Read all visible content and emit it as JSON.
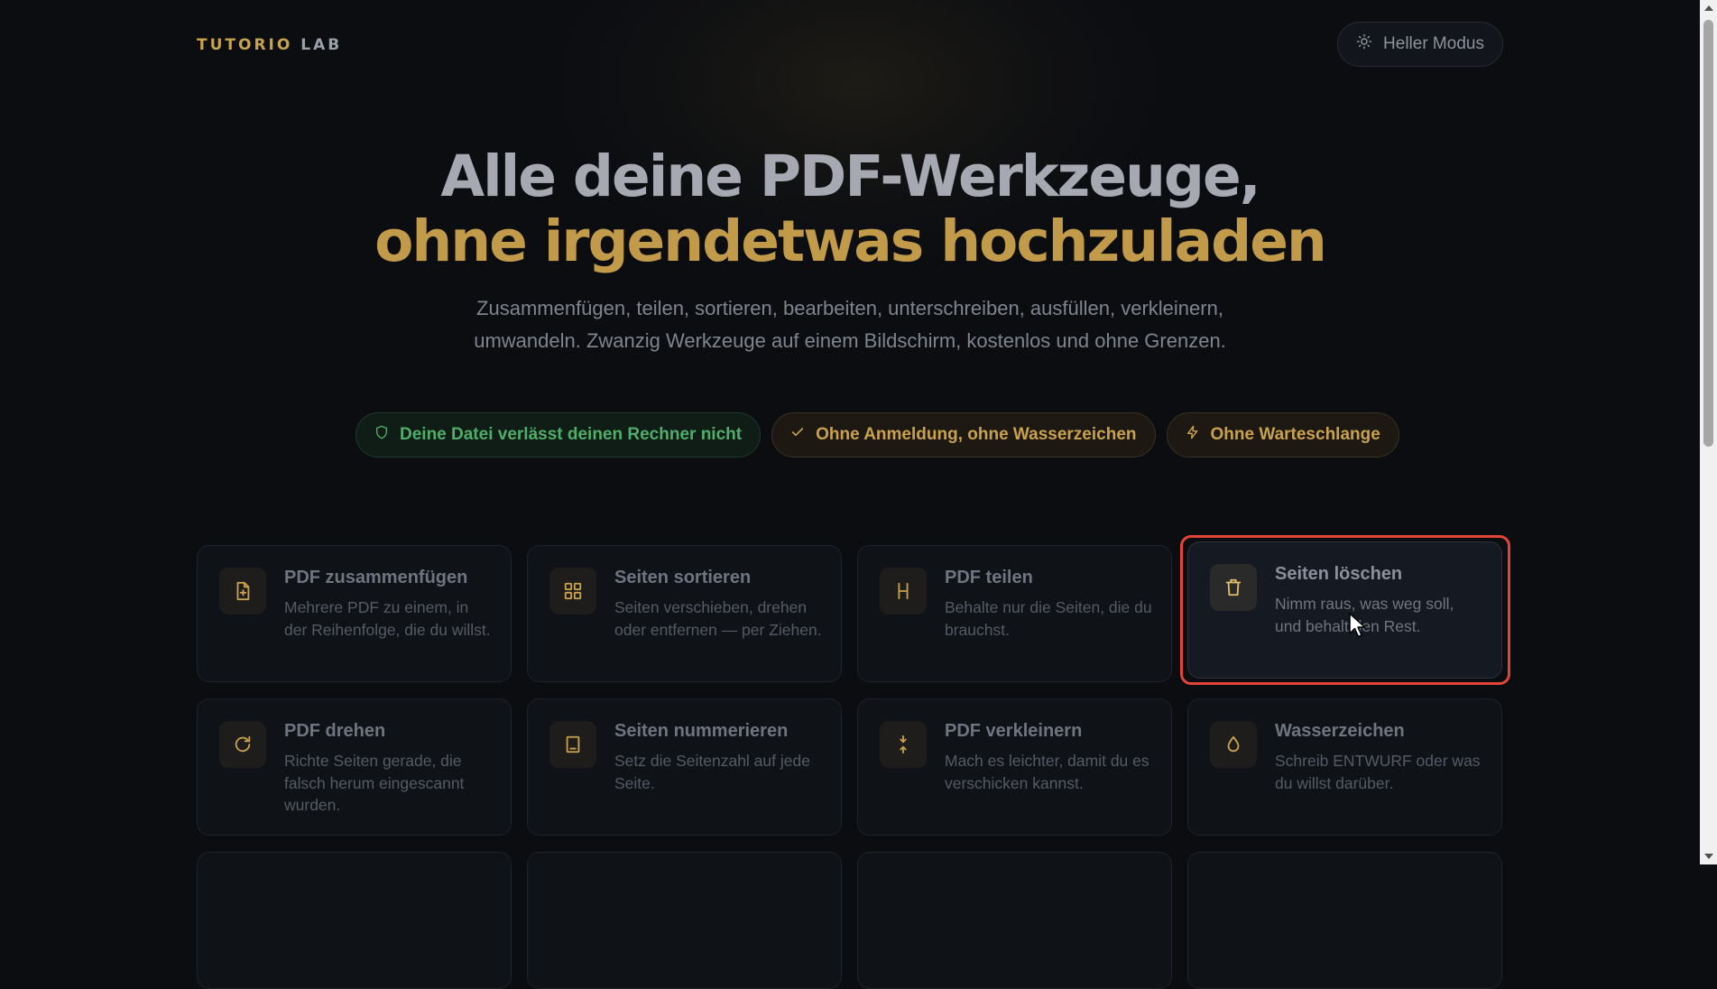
{
  "header": {
    "logo_part1": "TUTORIO",
    "logo_part2": "LAB",
    "mode_button_label": "Heller Modus",
    "mode_button_icon": "sun-icon"
  },
  "hero": {
    "title_line1": "Alle deine PDF-Werkzeuge,",
    "title_line2": "ohne irgendetwas hochzuladen",
    "subtitle": "Zusammenfügen, teilen, sortieren, bearbeiten, unterschreiben, ausfüllen, verkleinern, umwandeln. Zwanzig Werkzeuge auf einem Bildschirm, kostenlos und ohne Grenzen."
  },
  "badges": [
    {
      "label": "Deine Datei verlässt deinen Rechner nicht",
      "icon": "shield-icon",
      "color": "#4fae6a"
    },
    {
      "label": "Ohne Anmeldung, ohne Wasserzeichen",
      "icon": "check-icon",
      "color": "#c9a24e"
    },
    {
      "label": "Ohne Warteschlange",
      "icon": "lightning-icon",
      "color": "#c9a24e"
    }
  ],
  "tools": [
    {
      "title": "PDF zusammenfügen",
      "desc": "Mehrere PDF zu einem, in der Reihenfolge, die du willst.",
      "icon": "file-plus-icon"
    },
    {
      "title": "Seiten sortieren",
      "desc": "Seiten verschieben, drehen oder entfernen — per Ziehen.",
      "icon": "grid-icon"
    },
    {
      "title": "PDF teilen",
      "desc": "Behalte nur die Seiten, die du brauchst.",
      "icon": "split-icon"
    },
    {
      "title": "Seiten löschen",
      "desc": "Nimm raus, was weg soll, und behalt den Rest.",
      "icon": "trash-icon"
    },
    {
      "title": "PDF drehen",
      "desc": "Richte Seiten gerade, die falsch herum eingescannt wurden.",
      "icon": "rotate-icon"
    },
    {
      "title": "Seiten nummerieren",
      "desc": "Setz die Seitenzahl auf jede Seite.",
      "icon": "page-number-icon"
    },
    {
      "title": "PDF verkleinern",
      "desc": "Mach es leichter, damit du es verschicken kannst.",
      "icon": "compress-icon"
    },
    {
      "title": "Wasserzeichen",
      "desc": "Schreib ENTWURF oder was du willst darüber.",
      "icon": "droplet-icon"
    }
  ],
  "colors": {
    "accent": "#c9a24e",
    "background": "#0b0d11",
    "highlight_outline": "#e2443a"
  }
}
